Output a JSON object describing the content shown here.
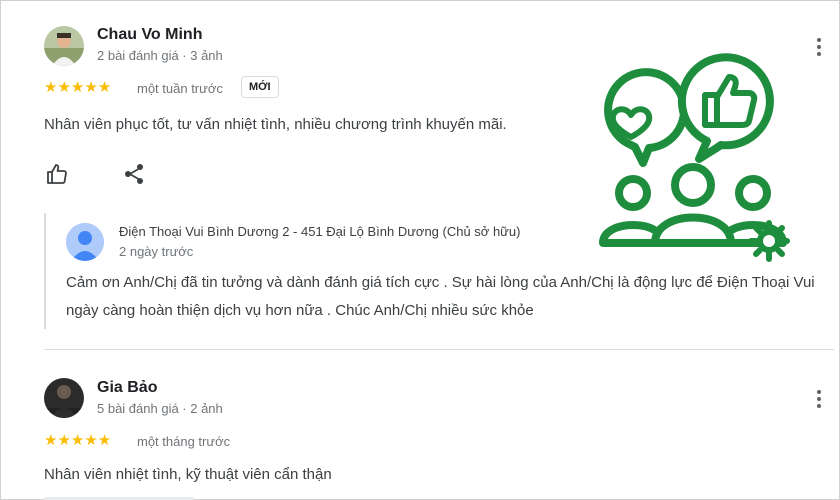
{
  "reviews": [
    {
      "name": "Chau Vo Minh",
      "meta": "2 bài đánh giá · 3 ảnh",
      "stars": "★★★★★",
      "time": "một tuần trước",
      "badge": "MỚI",
      "text": "Nhân viên phục tốt, tư vấn nhiệt tình, nhiều chương trình khuyến mãi.",
      "reply": {
        "owner": "Điện Thoại Vui Bình Dương 2 - 451 Đại Lộ Bình Dương (Chủ sở hữu)",
        "time": "2 ngày trước",
        "text": "Cảm ơn Anh/Chị đã tin tưởng và dành đánh giá tích cực . Sự hài lòng của Anh/Chị là động lực để Điện Thoại Vui ngày càng hoàn thiện dịch vụ hơn nữa . Chúc Anh/Chị nhiều sức khỏe"
      }
    },
    {
      "name": "Gia Bảo",
      "meta": "5 bài đánh giá · 2 ảnh",
      "stars": "★★★★★",
      "time": "một tháng trước",
      "text": "Nhân viên nhiệt tình, kỹ thuật viên cẩn thận"
    }
  ],
  "icons": {
    "like": "thumbs-up-icon",
    "share": "share-icon",
    "more": "more-vert-icon"
  },
  "colors": {
    "star": "#fbbc04",
    "illustration_green": "#1e8e3e",
    "owner_avatar": "#aecbfa"
  }
}
